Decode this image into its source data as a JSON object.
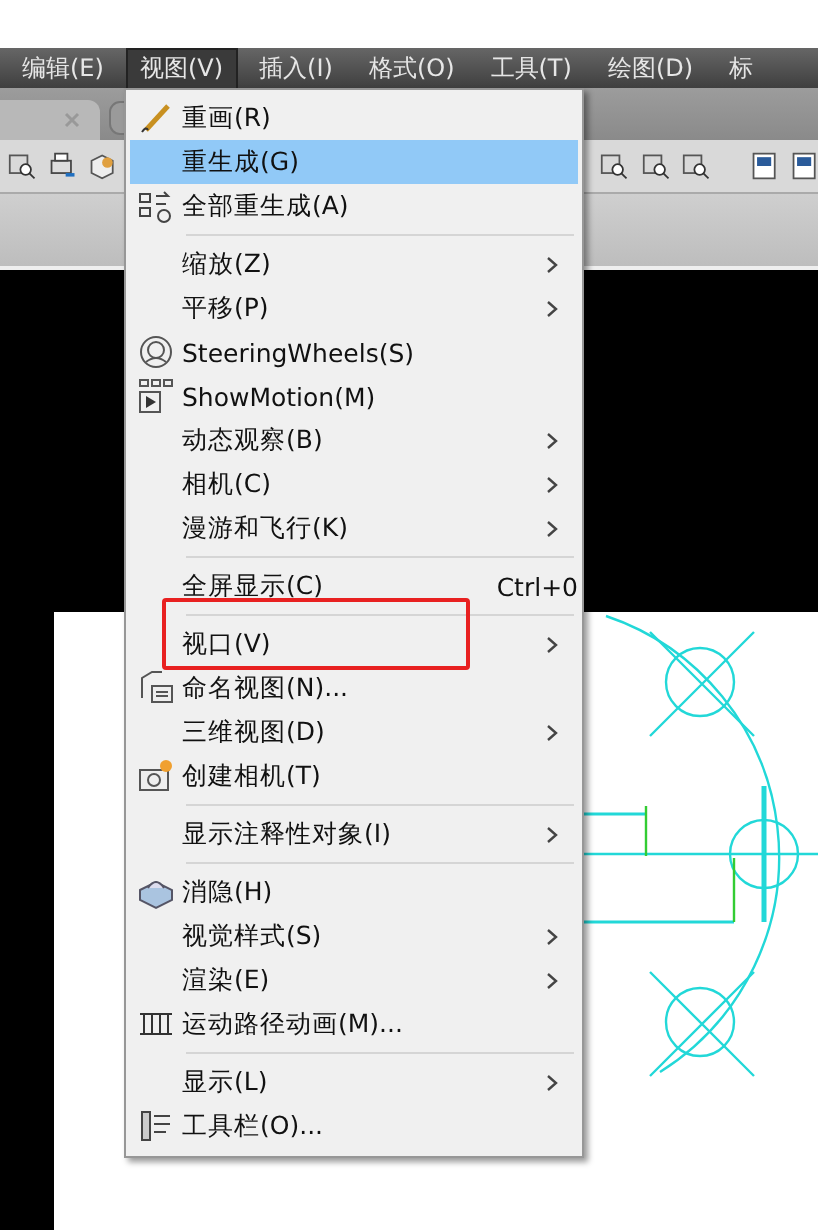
{
  "menubar": [
    {
      "label": "编辑(E)",
      "selected": false
    },
    {
      "label": "视图(V)",
      "selected": true
    },
    {
      "label": "插入(I)",
      "selected": false
    },
    {
      "label": "格式(O)",
      "selected": false
    },
    {
      "label": "工具(T)",
      "selected": false
    },
    {
      "label": "绘图(D)",
      "selected": false
    },
    {
      "label": "标",
      "selected": false
    }
  ],
  "menu": [
    {
      "kind": "item",
      "label": "重画(R)",
      "selected": false,
      "submenu": false
    },
    {
      "kind": "item",
      "label": "重生成(G)",
      "selected": true,
      "submenu": false
    },
    {
      "kind": "item",
      "label": "全部重生成(A)",
      "selected": false,
      "submenu": false
    },
    {
      "kind": "separator"
    },
    {
      "kind": "item",
      "label": "缩放(Z)",
      "selected": false,
      "submenu": true
    },
    {
      "kind": "item",
      "label": "平移(P)",
      "selected": false,
      "submenu": true
    },
    {
      "kind": "item",
      "label": "SteeringWheels(S)",
      "selected": false,
      "submenu": false
    },
    {
      "kind": "item",
      "label": "ShowMotion(M)",
      "selected": false,
      "submenu": false
    },
    {
      "kind": "item",
      "label": "动态观察(B)",
      "selected": false,
      "submenu": true
    },
    {
      "kind": "item",
      "label": "相机(C)",
      "selected": false,
      "submenu": true
    },
    {
      "kind": "item",
      "label": "漫游和飞行(K)",
      "selected": false,
      "submenu": true
    },
    {
      "kind": "separator"
    },
    {
      "kind": "item",
      "label": "全屏显示(C)",
      "shortcut": "Ctrl+0",
      "selected": false,
      "submenu": false
    },
    {
      "kind": "separator"
    },
    {
      "kind": "item",
      "label": "视口(V)",
      "selected": false,
      "submenu": true,
      "annotated": true
    },
    {
      "kind": "item",
      "label": "命名视图(N)...",
      "selected": false,
      "submenu": false
    },
    {
      "kind": "item",
      "label": "三维视图(D)",
      "selected": false,
      "submenu": true
    },
    {
      "kind": "item",
      "label": "创建相机(T)",
      "selected": false,
      "submenu": false
    },
    {
      "kind": "separator"
    },
    {
      "kind": "item",
      "label": "显示注释性对象(I)",
      "selected": false,
      "submenu": true
    },
    {
      "kind": "separator"
    },
    {
      "kind": "item",
      "label": "消隐(H)",
      "selected": false,
      "submenu": false
    },
    {
      "kind": "item",
      "label": "视觉样式(S)",
      "selected": false,
      "submenu": true
    },
    {
      "kind": "item",
      "label": "渲染(E)",
      "selected": false,
      "submenu": true
    },
    {
      "kind": "item",
      "label": "运动路径动画(M)...",
      "selected": false,
      "submenu": false
    },
    {
      "kind": "separator"
    },
    {
      "kind": "item",
      "label": "显示(L)",
      "selected": false,
      "submenu": true
    },
    {
      "kind": "item",
      "label": "工具栏(O)...",
      "selected": false,
      "submenu": false
    }
  ]
}
